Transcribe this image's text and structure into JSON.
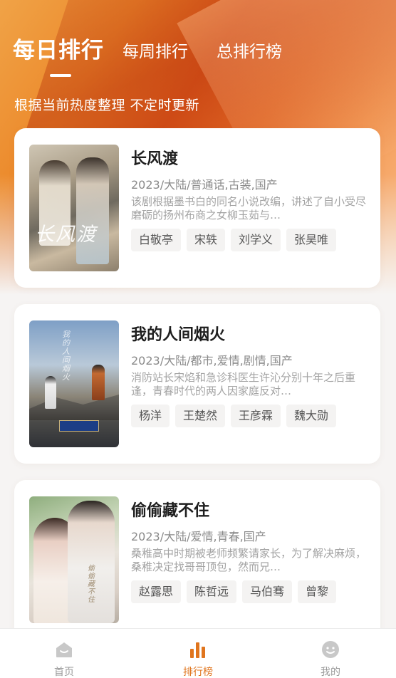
{
  "colors": {
    "accent": "#e0751e",
    "hero_start": "#f0a347",
    "hero_mid": "#d8541a",
    "card_bg": "#ffffff"
  },
  "tabs": [
    {
      "label": "每日排行",
      "active": true
    },
    {
      "label": "每周排行",
      "active": false
    },
    {
      "label": "总排行榜",
      "active": false
    }
  ],
  "subtitle": "根据当前热度整理 不定时更新",
  "shows": [
    {
      "title": "长风渡",
      "meta": "2023/大陆/普通话,古装,国产",
      "desc": "该剧根据墨书白的同名小说改编，讲述了自小受尽磨砺的扬州布商之女柳玉茹与…",
      "poster_text": "长风渡",
      "cast": [
        "白敬亭",
        "宋轶",
        "刘学义",
        "张昊唯"
      ]
    },
    {
      "title": "我的人间烟火",
      "meta": "2023/大陆/都市,爱情,剧情,国产",
      "desc": "消防站长宋焰和急诊科医生许沁分别十年之后重逢，青春时代的两人因家庭反对…",
      "poster_text": "我的人间烟火",
      "cast": [
        "杨洋",
        "王楚然",
        "王彦霖",
        "魏大勋"
      ]
    },
    {
      "title": "偷偷藏不住",
      "meta": "2023/大陆/爱情,青春,国产",
      "desc": "桑稚高中时期被老师频繁请家长，为了解决麻烦，桑稚决定找哥哥顶包，然而兄…",
      "poster_text": "偷偷藏不住",
      "cast": [
        "赵露思",
        "陈哲远",
        "马伯骞",
        "曾黎"
      ]
    }
  ],
  "bottom_nav": [
    {
      "label": "首页",
      "icon": "home-icon",
      "active": false
    },
    {
      "label": "排行榜",
      "icon": "bar-chart-icon",
      "active": true
    },
    {
      "label": "我的",
      "icon": "profile-icon",
      "active": false
    }
  ]
}
